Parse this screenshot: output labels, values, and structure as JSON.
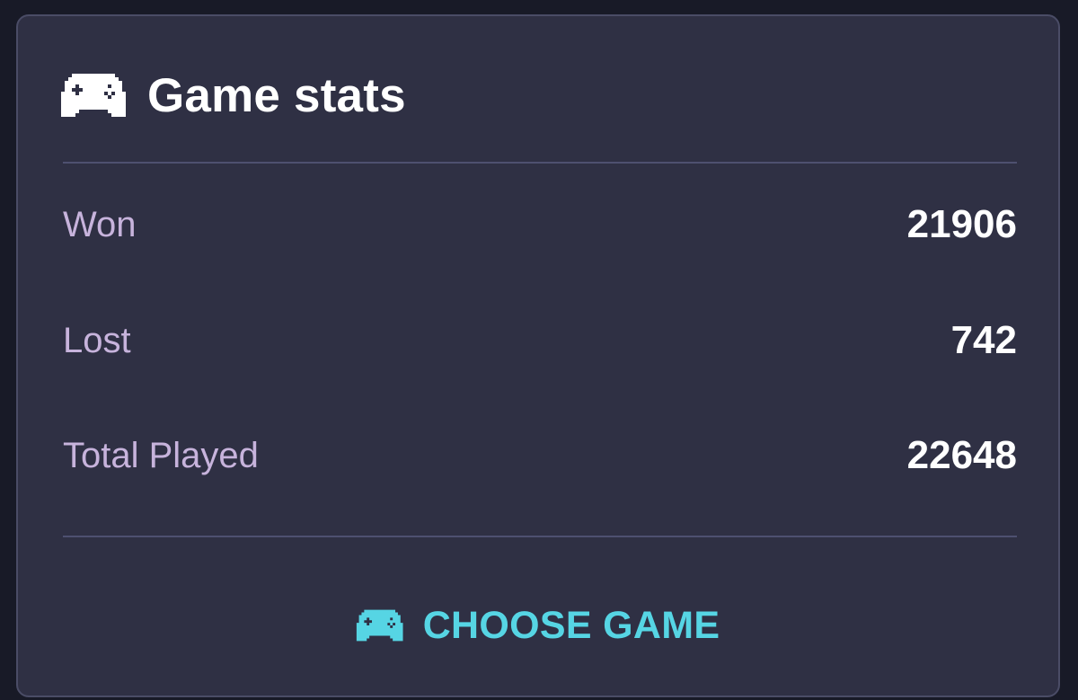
{
  "card": {
    "title": "Game stats",
    "icon": "gamepad-icon"
  },
  "stats": [
    {
      "label": "Won",
      "value": "21906"
    },
    {
      "label": "Lost",
      "value": "742"
    },
    {
      "label": "Total Played",
      "value": "22648"
    }
  ],
  "action": {
    "label": "CHOOSE GAME",
    "icon": "gamepad-icon"
  },
  "colors": {
    "background": "#181a27",
    "card": "#2f3044",
    "label": "#c7b3dc",
    "value": "#ffffff",
    "accent": "#56d5e4"
  }
}
